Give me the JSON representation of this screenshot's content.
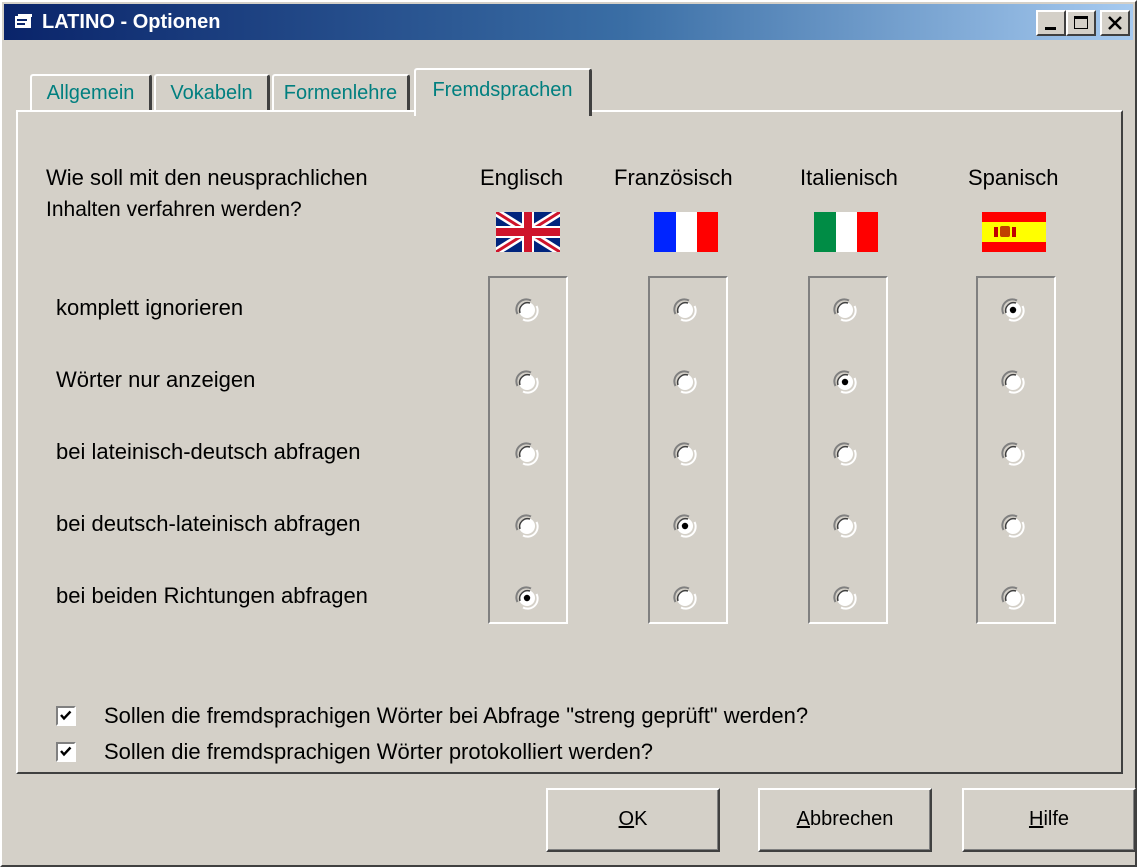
{
  "window": {
    "title": "LATINO - Optionen",
    "buttons": [
      "minimize",
      "maximize",
      "close"
    ]
  },
  "tabs": [
    {
      "label": "Allgemein",
      "active": false
    },
    {
      "label": "Vokabeln",
      "active": false
    },
    {
      "label": "Formenlehre",
      "active": false
    },
    {
      "label": "Fremdsprachen",
      "active": true
    }
  ],
  "question": {
    "line1": "Wie soll mit den neusprachlichen",
    "line2": "Inhalten verfahren werden?"
  },
  "languages": [
    {
      "label": "Englisch",
      "flag": "uk-flag-icon"
    },
    {
      "label": "Französisch",
      "flag": "france-flag-icon"
    },
    {
      "label": "Italienisch",
      "flag": "italy-flag-icon"
    },
    {
      "label": "Spanisch",
      "flag": "spain-flag-icon"
    }
  ],
  "options": [
    "komplett ignorieren",
    "Wörter nur anzeigen",
    "bei lateinisch-deutsch abfragen",
    "bei deutsch-lateinisch abfragen",
    "bei beiden Richtungen abfragen"
  ],
  "selected_option_index_per_language": [
    4,
    3,
    1,
    0
  ],
  "checkboxes": [
    {
      "label": "Sollen die fremdsprachigen Wörter bei Abfrage \"streng geprüft\" werden?",
      "checked": true
    },
    {
      "label": "Sollen die fremdsprachigen Wörter protokolliert werden?",
      "checked": true
    }
  ],
  "buttons": {
    "ok": {
      "mnemonic": "O",
      "rest": "K"
    },
    "cancel": {
      "mnemonic": "A",
      "rest": "bbrechen"
    },
    "help": {
      "mnemonic": "H",
      "rest": "ilfe"
    }
  },
  "colors": {
    "titlebar_start": "#0a246a",
    "titlebar_end": "#a6caf0",
    "face": "#d4d0c8",
    "tab_text": "#007f7f"
  }
}
